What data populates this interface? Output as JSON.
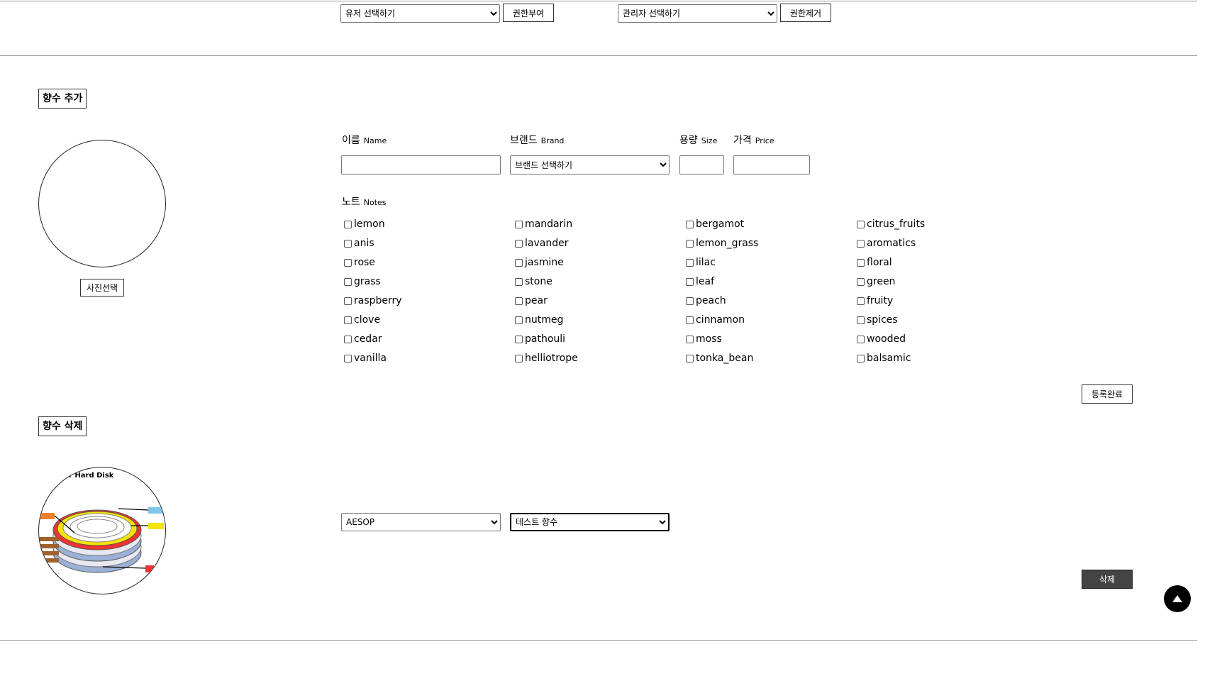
{
  "top_bar": {
    "user_select": "유저 선택하기",
    "grant_button": "권한부여",
    "admin_select": "관리자 선택하기",
    "revoke_button": "권한제거"
  },
  "add_section": {
    "title": "향수 추가",
    "photo_button": "사진선택",
    "name_label_ko": "이름",
    "name_label_en": "Name",
    "brand_label_ko": "브랜드",
    "brand_label_en": "Brand",
    "brand_select": "브랜드 선택하기",
    "size_label_ko": "용량",
    "size_label_en": "Size",
    "price_label_ko": "가격",
    "price_label_en": "Price",
    "notes_label_ko": "노트",
    "notes_label_en": "Notes",
    "notes": [
      [
        "lemon",
        "mandarin",
        "bergamot",
        "citrus_fruits"
      ],
      [
        "anis",
        "lavander",
        "lemon_grass",
        "aromatics"
      ],
      [
        "rose",
        "jasmine",
        "lilac",
        "floral"
      ],
      [
        "grass",
        "stone",
        "leaf",
        "green"
      ],
      [
        "raspberry",
        "pear",
        "peach",
        "fruity"
      ],
      [
        "clove",
        "nutmeg",
        "cinnamon",
        "spices"
      ],
      [
        "cedar",
        "pathouli",
        "moss",
        "wooded"
      ],
      [
        "vanilla",
        "helliotrope",
        "tonka_bean",
        "balsamic"
      ]
    ],
    "submit_button": "등록완료"
  },
  "delete_section": {
    "title": "향수 삭제",
    "image_caption": "r Hard Disk",
    "brand_select": "AESOP",
    "perfume_select": "테스트 향수",
    "delete_button": "삭제"
  },
  "colors": {
    "delete_button_bg": "#444444",
    "scroll_top_bg": "#000000"
  }
}
